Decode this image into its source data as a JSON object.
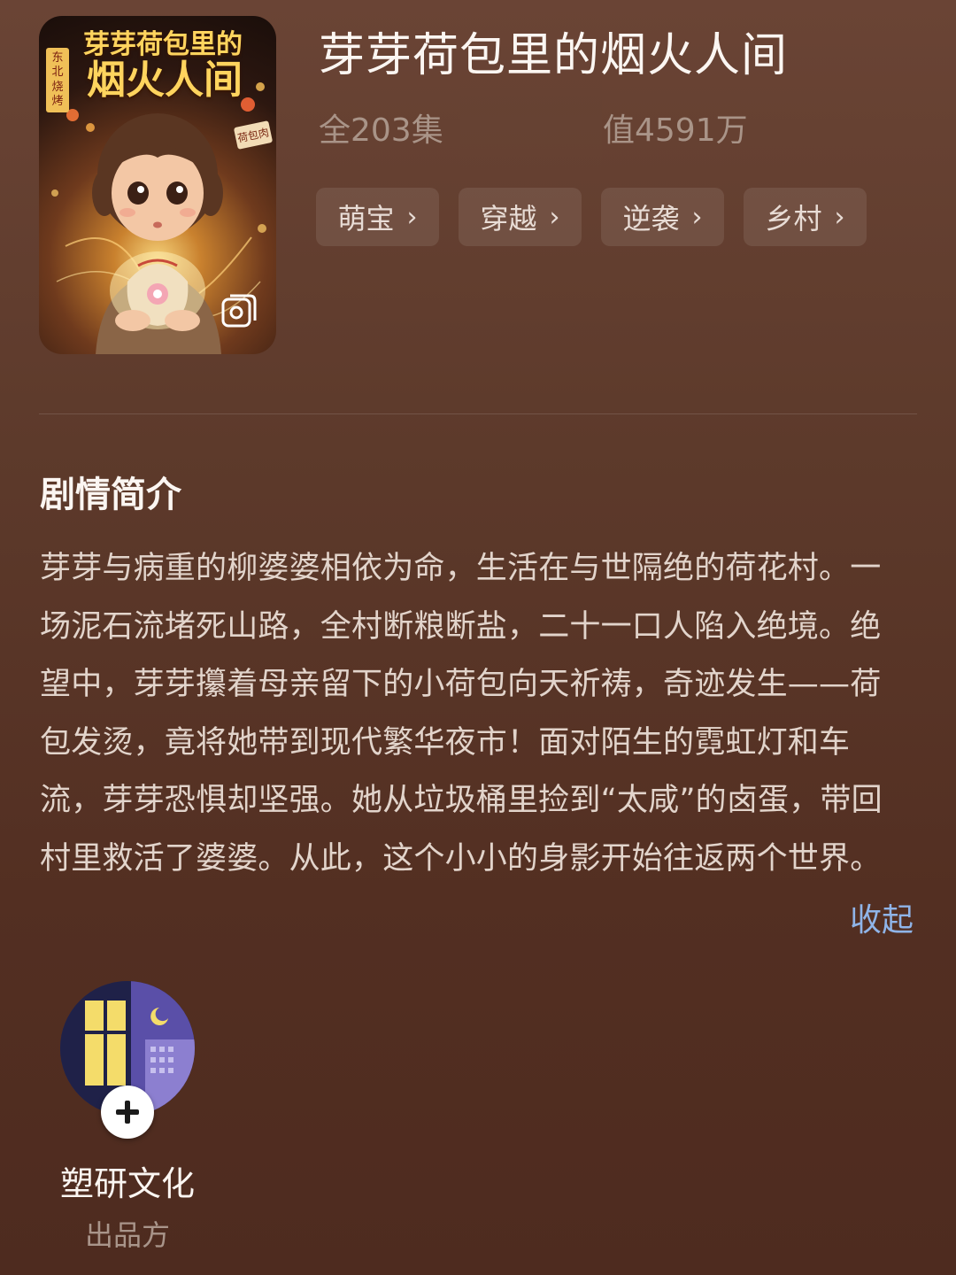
{
  "cover": {
    "title_line1": "芽芽荷包里的",
    "title_line2": "烟火人间",
    "side_sign": "东北烧烤",
    "shop_sign": "荷包肉",
    "badge_icon": "gallery-icon"
  },
  "drama": {
    "title": "芽芽荷包里的烟火人间",
    "episodes": "全203集",
    "heat": "值4591万"
  },
  "tags": [
    {
      "label": "萌宝"
    },
    {
      "label": "穿越"
    },
    {
      "label": "逆袭"
    },
    {
      "label": "乡村"
    }
  ],
  "synopsis": {
    "heading": "剧情简介",
    "text": "芽芽与病重的柳婆婆相依为命，生活在与世隔绝的荷花村。一场泥石流堵死山路，全村断粮断盐，二十一口人陷入绝境。绝望中，芽芽攥着母亲留下的小荷包向天祈祷，奇迹发生——荷包发烫，竟将她带到现代繁华夜市！面对陌生的霓虹灯和车流，芽芽恐惧却坚强。她从垃圾桶里捡到“太咸”的卤蛋，带回村里救活了婆婆。从此，这个小小的身影开始往返两个世界。",
    "collapse_label": "收起"
  },
  "producer": {
    "name": "塑研文化",
    "role_label": "出品方",
    "follow_icon": "plus-icon"
  },
  "colors": {
    "background_top": "#6a4435",
    "background_bottom": "#4e2b1f",
    "link": "#8fb4e8",
    "muted": "#a99488"
  }
}
